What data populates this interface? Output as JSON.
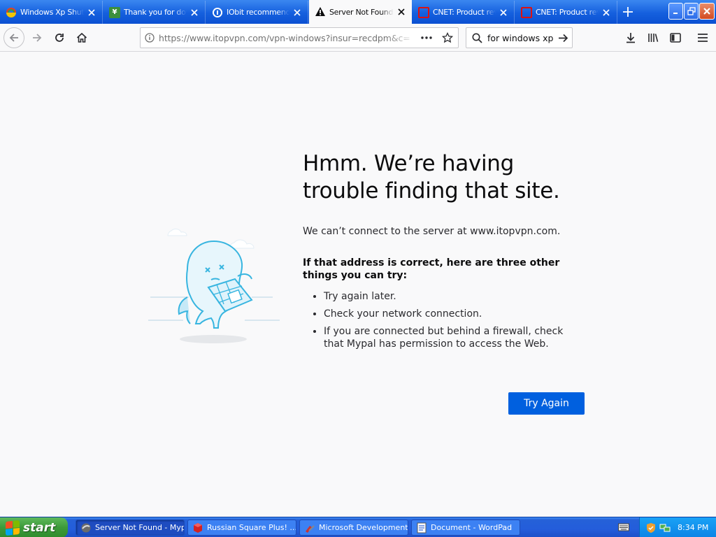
{
  "tabs": [
    {
      "title": "Windows Xp Shutdown",
      "favicon": "rainbow-globe-icon",
      "active": false
    },
    {
      "title": "Thank you for downloading",
      "favicon": "green-download-icon",
      "active": false
    },
    {
      "title": "IObit recommends",
      "favicon": "iobit-icon",
      "active": false
    },
    {
      "title": "Server Not Found",
      "favicon": "warning-icon",
      "active": true
    },
    {
      "title": "CNET: Product reviews",
      "favicon": "cnet-icon",
      "active": false
    },
    {
      "title": "CNET: Product reviews",
      "favicon": "cnet-icon",
      "active": false
    }
  ],
  "navbar": {
    "url": "https://www.itopvpn.com/vpn-windows?insur=recdpm&c=",
    "search_value": "for windows xp"
  },
  "error": {
    "title": "Hmm. We’re having trouble finding that site.",
    "description": "We can’t connect to the server at www.itopvpn.com.",
    "advice": "If that address is correct, here are three other things you can try:",
    "tips": [
      "Try again later.",
      "Check your network connection.",
      "If you are connected but behind a firewall, check that Mypal has permission to access the Web."
    ],
    "try_again_label": "Try Again"
  },
  "taskbar": {
    "start_label": "start",
    "tasks": [
      {
        "label": "Server Not Found - Mypal",
        "icon": "mypal-icon",
        "active": true
      },
      {
        "label": "Russian Square Plus! ...",
        "icon": "cube-icon",
        "active": false
      },
      {
        "label": "Microsoft Development ...",
        "icon": "tools-icon",
        "active": false
      },
      {
        "label": "Document - WordPad",
        "icon": "wordpad-icon",
        "active": false
      }
    ],
    "clock": "8:34 PM"
  },
  "colors": {
    "accent": "#0060df",
    "tabstrip": "#1560de",
    "taskbar": "#245ddb",
    "start": "#3c9a3a"
  }
}
